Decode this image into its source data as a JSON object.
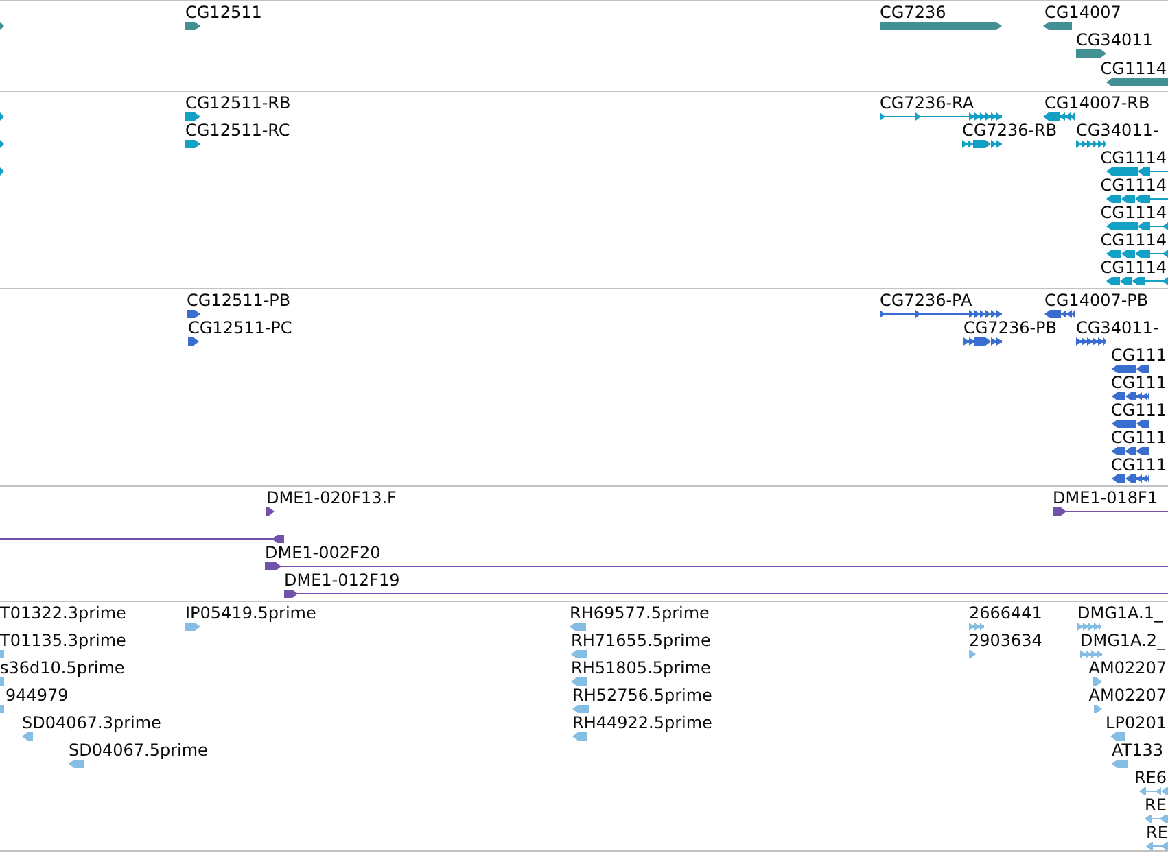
{
  "tracks": [
    {
      "kind": "gene",
      "features": [
        {
          "reverse": false
        },
        {
          "label": "CG12511",
          "reverse": false
        },
        {
          "label": "CG7236",
          "reverse": false
        },
        {
          "label": "CG14007",
          "reverse": true
        },
        {
          "label": "CG34011",
          "reverse": false
        },
        {
          "label": "CG1114",
          "reverse": true
        }
      ]
    },
    {
      "kind": "transcript",
      "features": [
        {
          "reverse": false
        },
        {
          "label": "CG12511-RB",
          "reverse": false
        },
        {
          "label": "CG7236-RA",
          "reverse": false
        },
        {
          "label": "CG14007-RB",
          "reverse": true
        },
        {
          "reverse": false
        },
        {
          "label": "CG12511-RC",
          "reverse": false
        },
        {
          "label": "CG7236-RB",
          "reverse": false
        },
        {
          "label": "CG34011-",
          "reverse": false
        },
        {
          "reverse": false
        },
        {
          "label": "CG1114",
          "reverse": true
        },
        {
          "label": "CG1114",
          "reverse": true
        },
        {
          "label": "CG1114",
          "reverse": true
        },
        {
          "label": "CG1114",
          "reverse": true
        },
        {
          "label": "CG1114",
          "reverse": true
        }
      ]
    },
    {
      "kind": "protein",
      "features": [
        {
          "label": "CG12511-PB",
          "reverse": false
        },
        {
          "label": "CG7236-PA",
          "reverse": false
        },
        {
          "label": "CG14007-PB",
          "reverse": true
        },
        {
          "label": "CG12511-PC",
          "reverse": false
        },
        {
          "label": "CG7236-PB",
          "reverse": false
        },
        {
          "label": "CG34011-",
          "reverse": false
        },
        {
          "label": "CG111",
          "reverse": true
        },
        {
          "label": "CG111",
          "reverse": true
        },
        {
          "label": "CG111",
          "reverse": true
        },
        {
          "label": "CG111",
          "reverse": true
        },
        {
          "label": "CG111",
          "reverse": true
        }
      ]
    },
    {
      "kind": "clone",
      "features": [
        {
          "label": "DME1-020F13.F",
          "reverse": false
        },
        {
          "label": "DME1-018F1",
          "reverse": false
        },
        {
          "reverse": true
        },
        {
          "label": "DME1-002F20",
          "reverse": false
        },
        {
          "label": "DME1-012F19",
          "reverse": false
        }
      ]
    },
    {
      "kind": "est",
      "features": [
        {
          "label": "T01322.3prime"
        },
        {
          "label": "IP05419.5prime",
          "reverse": false
        },
        {
          "label": "RH69577.5prime",
          "reverse": true
        },
        {
          "label": "2666441",
          "reverse": false
        },
        {
          "label": "DMG1A.1_",
          "reverse": false
        },
        {
          "label": "T01135.3prime",
          "reverse": true
        },
        {
          "label": "RH71655.5prime",
          "reverse": true
        },
        {
          "label": "2903634",
          "reverse": false
        },
        {
          "label": "DMG1A.2_",
          "reverse": false
        },
        {
          "label": "s36d10.5prime",
          "reverse": true
        },
        {
          "label": "RH51805.5prime",
          "reverse": true
        },
        {
          "label": "AM02207",
          "reverse": false
        },
        {
          "label": "944979",
          "reverse": true
        },
        {
          "label": "RH52756.5prime",
          "reverse": true
        },
        {
          "label": "AM02207",
          "reverse": false
        },
        {
          "label": "SD04067.3prime",
          "reverse": true
        },
        {
          "label": "RH44922.5prime",
          "reverse": true
        },
        {
          "label": "LP0201",
          "reverse": true
        },
        {
          "label": "SD04067.5prime",
          "reverse": true
        },
        {
          "label": "AT133",
          "reverse": true
        },
        {
          "label": "RE6",
          "reverse": true
        },
        {
          "label": "RE",
          "reverse": true
        },
        {
          "label": "RE",
          "reverse": true
        }
      ]
    }
  ]
}
